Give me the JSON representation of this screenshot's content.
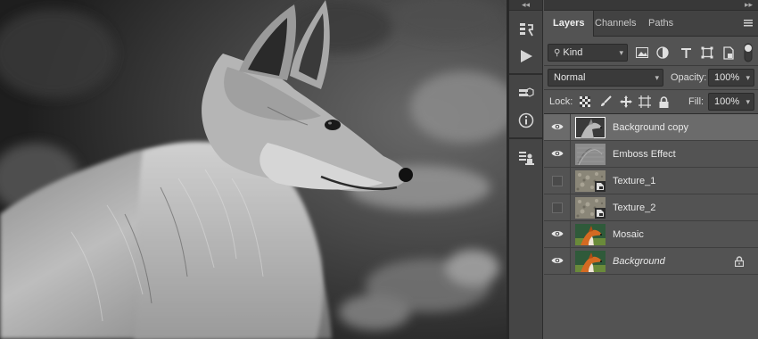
{
  "panel_tabs": [
    "Layers",
    "Channels",
    "Paths"
  ],
  "filter": {
    "label": "Kind"
  },
  "blend": {
    "mode": "Normal",
    "opacity_label": "Opacity:",
    "opacity_value": "100%"
  },
  "lock": {
    "label": "Lock:",
    "fill_label": "Fill:",
    "fill_value": "100%"
  },
  "layers": [
    {
      "name": "Background copy",
      "visible": true,
      "selected": true,
      "italic": false,
      "thumb": "fox-gray",
      "locked": false
    },
    {
      "name": "Emboss Effect",
      "visible": true,
      "selected": false,
      "italic": false,
      "thumb": "emboss",
      "locked": false
    },
    {
      "name": "Texture_1",
      "visible": false,
      "selected": false,
      "italic": false,
      "thumb": "texture",
      "locked": false
    },
    {
      "name": "Texture_2",
      "visible": false,
      "selected": false,
      "italic": false,
      "thumb": "texture",
      "locked": false
    },
    {
      "name": "Mosaic",
      "visible": true,
      "selected": false,
      "italic": false,
      "thumb": "fox-color",
      "locked": false
    },
    {
      "name": "Background",
      "visible": true,
      "selected": false,
      "italic": true,
      "thumb": "fox-color",
      "locked": true
    }
  ],
  "colors": {
    "panel": "#535353",
    "selected_row": "#6b6b6b",
    "field": "#3a3a3a"
  },
  "icons": [
    "history-icon",
    "play-icon",
    "3d-cube-icon",
    "info-icon",
    "clone-source-icon",
    "eye-icon",
    "lock-icon"
  ]
}
